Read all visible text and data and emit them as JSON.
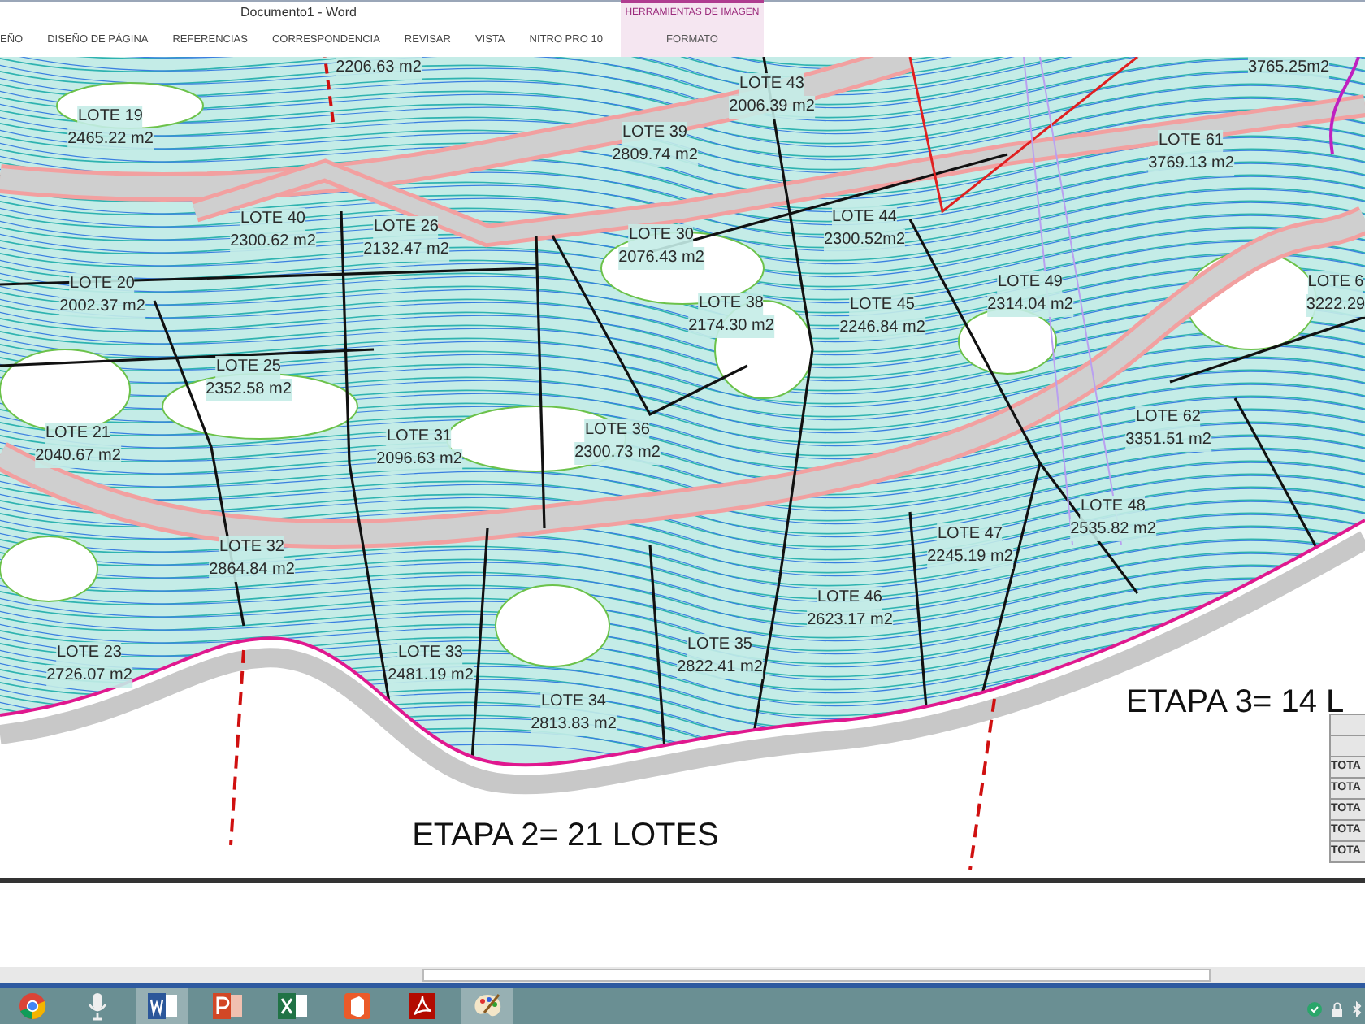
{
  "window": {
    "title": "Documento1 - Word"
  },
  "ribbon": {
    "tabs": [
      {
        "label": "EÑO",
        "selected": false
      },
      {
        "label": "DISEÑO DE PÁGINA",
        "selected": false
      },
      {
        "label": "REFERENCIAS",
        "selected": false
      },
      {
        "label": "CORRESPONDENCIA",
        "selected": false
      },
      {
        "label": "REVISAR",
        "selected": false
      },
      {
        "label": "VISTA",
        "selected": false
      },
      {
        "label": "NITRO PRO 10",
        "selected": false
      }
    ],
    "context_group": {
      "title": "HERRAMIENTAS DE IMAGEN",
      "tabs": [
        {
          "label": "FORMATO",
          "selected": false
        }
      ]
    }
  },
  "site_plan": {
    "lots": [
      {
        "name": "LOTE 19",
        "area": "2465.22 m2"
      },
      {
        "name": "LOTE 39",
        "area": "2809.74 m2"
      },
      {
        "name": "LOTE 43",
        "area": "2006.39 m2"
      },
      {
        "name": "LOTE 61",
        "area": "3769.13 m2"
      },
      {
        "name": "LOTE 40",
        "area": "2300.62 m2"
      },
      {
        "name": "LOTE 26",
        "area": "2132.47 m2"
      },
      {
        "name": "LOTE 30",
        "area": "2076.43 m2"
      },
      {
        "name": "LOTE 44",
        "area": "2300.52m2"
      },
      {
        "name": "LOTE 20",
        "area": "2002.37 m2"
      },
      {
        "name": "LOTE 38",
        "area": "2174.30 m2"
      },
      {
        "name": "LOTE 45",
        "area": "2246.84 m2"
      },
      {
        "name": "LOTE 49",
        "area": "2314.04 m2"
      },
      {
        "name": "LOTE 6",
        "area": "3222.29"
      },
      {
        "name": "LOTE 25",
        "area": "2352.58 m2"
      },
      {
        "name": "LOTE 21",
        "area": "2040.67 m2"
      },
      {
        "name": "LOTE 31",
        "area": "2096.63 m2"
      },
      {
        "name": "LOTE 36",
        "area": "2300.73 m2"
      },
      {
        "name": "LOTE 62",
        "area": "3351.51 m2"
      },
      {
        "name": "LOTE 32",
        "area": "2864.84 m2"
      },
      {
        "name": "LOTE 47",
        "area": "2245.19 m2"
      },
      {
        "name": "LOTE 48",
        "area": "2535.82 m2"
      },
      {
        "name": "LOTE 46",
        "area": "2623.17 m2"
      },
      {
        "name": "LOTE 23",
        "area": "2726.07 m2"
      },
      {
        "name": "LOTE 33",
        "area": "2481.19 m2"
      },
      {
        "name": "LOTE 35",
        "area": "2822.41 m2"
      },
      {
        "name": "LOTE 34",
        "area": "2813.83 m2"
      }
    ],
    "cut_areas": [
      "2206.63 m2",
      "3765.25m2"
    ],
    "stage_labels": [
      "ETAPA 2= 21 LOTES",
      "ETAPA 3= 14 L"
    ],
    "table_rows": [
      "TOTA",
      "TOTA",
      "TOTA",
      "TOTA",
      "TOTA"
    ]
  },
  "taskbar": {
    "apps": [
      {
        "kind": "chrome",
        "selected": false
      },
      {
        "kind": "microphone",
        "selected": false
      },
      {
        "kind": "word",
        "selected": true
      },
      {
        "kind": "powerpoint",
        "selected": false
      },
      {
        "kind": "excel",
        "selected": false
      },
      {
        "kind": "office",
        "selected": false
      },
      {
        "kind": "acrobat",
        "selected": false
      },
      {
        "kind": "paint",
        "selected": true
      }
    ]
  }
}
